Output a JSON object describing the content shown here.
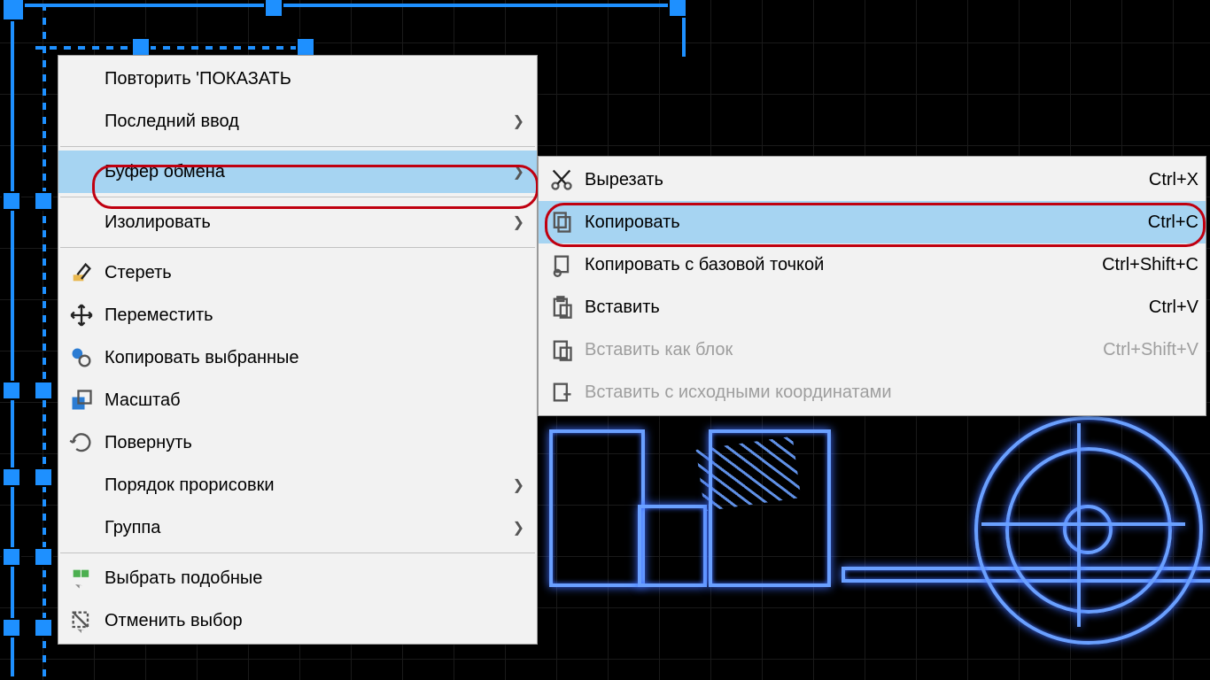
{
  "context_menu": {
    "items": [
      {
        "label": "Повторить 'ПОКАЗАТЬ"
      },
      {
        "label": "Последний ввод"
      },
      {
        "label": "Буфер обмена"
      },
      {
        "label": "Изолировать"
      },
      {
        "label": "Стереть"
      },
      {
        "label": "Переместить"
      },
      {
        "label": "Копировать выбранные"
      },
      {
        "label": "Масштаб"
      },
      {
        "label": "Повернуть"
      },
      {
        "label": "Порядок прорисовки"
      },
      {
        "label": "Группа"
      },
      {
        "label": "Выбрать подобные"
      },
      {
        "label": "Отменить выбор"
      }
    ]
  },
  "clipboard_submenu": {
    "items": [
      {
        "label": "Вырезать",
        "shortcut": "Ctrl+X"
      },
      {
        "label": "Копировать",
        "shortcut": "Ctrl+C"
      },
      {
        "label": "Копировать с базовой точкой",
        "shortcut": "Ctrl+Shift+C"
      },
      {
        "label": "Вставить",
        "shortcut": "Ctrl+V"
      },
      {
        "label": "Вставить как блок",
        "shortcut": "Ctrl+Shift+V"
      },
      {
        "label": "Вставить с исходными координатами",
        "shortcut": ""
      }
    ]
  }
}
